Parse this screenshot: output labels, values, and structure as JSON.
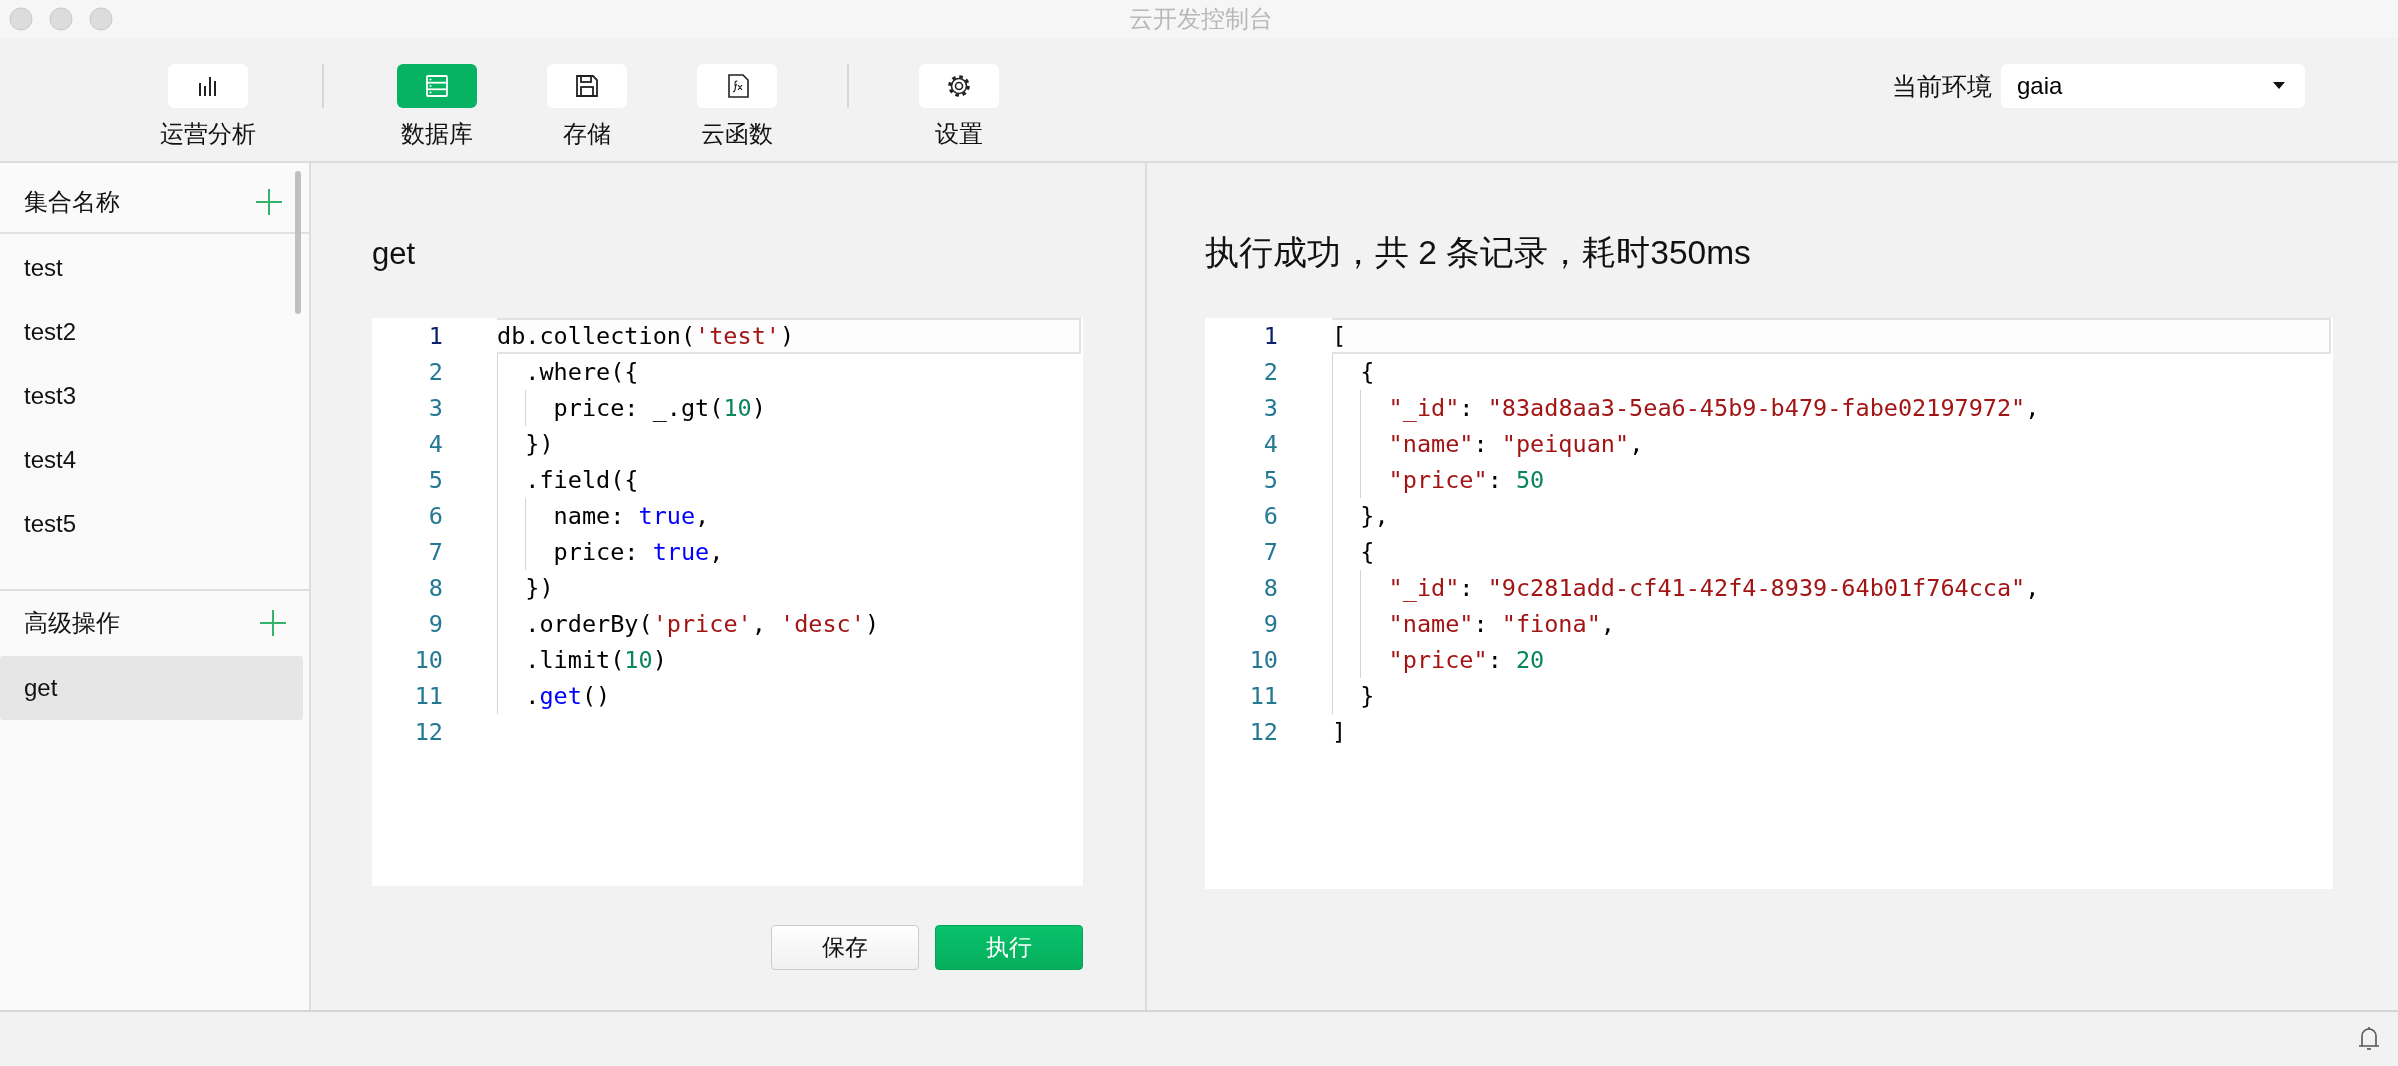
{
  "window": {
    "title": "云开发控制台"
  },
  "toolbar": {
    "groups": [
      {
        "items": [
          {
            "label": "运营分析",
            "kind": "chart",
            "selected": false
          }
        ]
      },
      {
        "items": [
          {
            "label": "数据库",
            "kind": "database",
            "selected": true
          },
          {
            "label": "存储",
            "kind": "storage",
            "selected": false
          },
          {
            "label": "云函数",
            "kind": "function",
            "selected": false
          }
        ]
      },
      {
        "items": [
          {
            "label": "设置",
            "kind": "settings",
            "selected": false
          }
        ]
      }
    ],
    "environment": {
      "label": "当前环境",
      "value": "gaia"
    }
  },
  "sidebar": {
    "sections": [
      {
        "title": "集合名称",
        "items": [
          {
            "label": "test",
            "selected": false
          },
          {
            "label": "test2",
            "selected": false
          },
          {
            "label": "test3",
            "selected": false
          },
          {
            "label": "test4",
            "selected": false
          },
          {
            "label": "test5",
            "selected": false
          }
        ]
      },
      {
        "title": "高级操作",
        "items": [
          {
            "label": "get",
            "selected": true
          }
        ]
      }
    ]
  },
  "query": {
    "title": "get",
    "editor": {
      "lines": [
        {
          "number": "1",
          "active": true,
          "tokens": [
            {
              "text": "db.collection(",
              "kind": "plain"
            },
            {
              "text": "'test'",
              "kind": "string"
            },
            {
              "text": ")",
              "kind": "plain"
            }
          ]
        },
        {
          "number": "2",
          "active": false,
          "tokens": [
            {
              "text": "  .where({",
              "kind": "plain"
            }
          ]
        },
        {
          "number": "3",
          "active": false,
          "tokens": [
            {
              "text": "    price: _.gt(",
              "kind": "plain"
            },
            {
              "text": "10",
              "kind": "number"
            },
            {
              "text": ")",
              "kind": "plain"
            }
          ]
        },
        {
          "number": "4",
          "active": false,
          "tokens": [
            {
              "text": "  })",
              "kind": "plain"
            }
          ]
        },
        {
          "number": "5",
          "active": false,
          "tokens": [
            {
              "text": "  .field({",
              "kind": "plain"
            }
          ]
        },
        {
          "number": "6",
          "active": false,
          "tokens": [
            {
              "text": "    name: ",
              "kind": "plain"
            },
            {
              "text": "true",
              "kind": "keyword"
            },
            {
              "text": ",",
              "kind": "plain"
            }
          ]
        },
        {
          "number": "7",
          "active": false,
          "tokens": [
            {
              "text": "    price: ",
              "kind": "plain"
            },
            {
              "text": "true",
              "kind": "keyword"
            },
            {
              "text": ",",
              "kind": "plain"
            }
          ]
        },
        {
          "number": "8",
          "active": false,
          "tokens": [
            {
              "text": "  })",
              "kind": "plain"
            }
          ]
        },
        {
          "number": "9",
          "active": false,
          "tokens": [
            {
              "text": "  .orderBy(",
              "kind": "plain"
            },
            {
              "text": "'price'",
              "kind": "string"
            },
            {
              "text": ", ",
              "kind": "plain"
            },
            {
              "text": "'desc'",
              "kind": "string"
            },
            {
              "text": ")",
              "kind": "plain"
            }
          ]
        },
        {
          "number": "10",
          "active": false,
          "tokens": [
            {
              "text": "  .limit(",
              "kind": "plain"
            },
            {
              "text": "10",
              "kind": "number"
            },
            {
              "text": ")",
              "kind": "plain"
            }
          ]
        },
        {
          "number": "11",
          "active": false,
          "tokens": [
            {
              "text": "  .",
              "kind": "plain"
            },
            {
              "text": "get",
              "kind": "keyword"
            },
            {
              "text": "()",
              "kind": "plain"
            }
          ]
        },
        {
          "number": "12",
          "active": false
        }
      ]
    },
    "buttons": [
      {
        "label": "保存",
        "kind": "secondary"
      },
      {
        "label": "执行",
        "kind": "primary"
      }
    ]
  },
  "result": {
    "title": "执行成功，共 2 条记录，耗时350ms",
    "editor": {
      "lines": [
        {
          "number": "1",
          "active": true,
          "tokens": [
            {
              "text": "[",
              "kind": "plain"
            }
          ]
        },
        {
          "number": "2",
          "active": false,
          "tokens": [
            {
              "text": "  {",
              "kind": "plain"
            }
          ]
        },
        {
          "number": "3",
          "active": false,
          "tokens": [
            {
              "text": "    \"_id\"",
              "kind": "string"
            },
            {
              "text": ": ",
              "kind": "plain"
            },
            {
              "text": "\"83ad8aa3-5ea6-45b9-b479-fabe02197972\"",
              "kind": "string"
            },
            {
              "text": ",",
              "kind": "plain"
            }
          ]
        },
        {
          "number": "4",
          "active": false,
          "tokens": [
            {
              "text": "    \"name\"",
              "kind": "string"
            },
            {
              "text": ": ",
              "kind": "plain"
            },
            {
              "text": "\"peiquan\"",
              "kind": "string"
            },
            {
              "text": ",",
              "kind": "plain"
            }
          ]
        },
        {
          "number": "5",
          "active": false,
          "tokens": [
            {
              "text": "    \"price\"",
              "kind": "string"
            },
            {
              "text": ": ",
              "kind": "plain"
            },
            {
              "text": "50",
              "kind": "number"
            }
          ]
        },
        {
          "number": "6",
          "active": false,
          "tokens": [
            {
              "text": "  },",
              "kind": "plain"
            }
          ]
        },
        {
          "number": "7",
          "active": false,
          "tokens": [
            {
              "text": "  {",
              "kind": "plain"
            }
          ]
        },
        {
          "number": "8",
          "active": false,
          "tokens": [
            {
              "text": "    \"_id\"",
              "kind": "string"
            },
            {
              "text": ": ",
              "kind": "plain"
            },
            {
              "text": "\"9c281add-cf41-42f4-8939-64b01f764cca\"",
              "kind": "string"
            },
            {
              "text": ",",
              "kind": "plain"
            }
          ]
        },
        {
          "number": "9",
          "active": false,
          "tokens": [
            {
              "text": "    \"name\"",
              "kind": "string"
            },
            {
              "text": ": ",
              "kind": "plain"
            },
            {
              "text": "\"fiona\"",
              "kind": "string"
            },
            {
              "text": ",",
              "kind": "plain"
            }
          ]
        },
        {
          "number": "10",
          "active": false,
          "tokens": [
            {
              "text": "    \"price\"",
              "kind": "string"
            },
            {
              "text": ": ",
              "kind": "plain"
            },
            {
              "text": "20",
              "kind": "number"
            }
          ]
        },
        {
          "number": "11",
          "active": false,
          "tokens": [
            {
              "text": "  }",
              "kind": "plain"
            }
          ]
        },
        {
          "number": "12",
          "active": false,
          "tokens": [
            {
              "text": "]",
              "kind": "plain"
            }
          ]
        }
      ]
    }
  }
}
